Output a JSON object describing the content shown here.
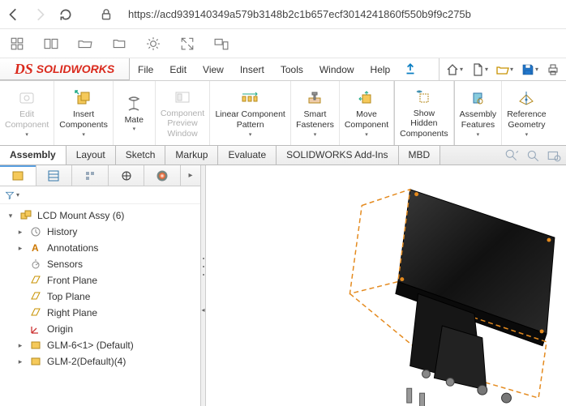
{
  "browser": {
    "url": "https://acd939140349a579b3148b2c1b657ecf3014241860f550b9f9c275b"
  },
  "app": {
    "logo": "SOLIDWORKS",
    "menus": [
      "File",
      "Edit",
      "View",
      "Insert",
      "Tools",
      "Window",
      "Help"
    ]
  },
  "ribbon": [
    {
      "id": "edit-component",
      "label": "Edit\nComponent",
      "disabled": true
    },
    {
      "id": "insert-components",
      "label": "Insert\nComponents"
    },
    {
      "id": "mate",
      "label": "Mate"
    },
    {
      "id": "component-preview",
      "label": "Component\nPreview\nWindow",
      "disabled": true
    },
    {
      "id": "linear-pattern",
      "label": "Linear Component\nPattern"
    },
    {
      "id": "smart-fasteners",
      "label": "Smart\nFasteners"
    },
    {
      "id": "move-component",
      "label": "Move\nComponent"
    },
    {
      "id": "show-hidden",
      "label": "Show\nHidden\nComponents"
    },
    {
      "id": "assembly-features",
      "label": "Assembly\nFeatures"
    },
    {
      "id": "reference-geometry",
      "label": "Reference\nGeometry"
    }
  ],
  "tabs": [
    "Assembly",
    "Layout",
    "Sketch",
    "Markup",
    "Evaluate",
    "SOLIDWORKS Add-Ins",
    "MBD"
  ],
  "active_tab": "Assembly",
  "tree": {
    "root": "LCD Mount Assy  (6)",
    "items": [
      {
        "label": "History",
        "icon": "history"
      },
      {
        "label": "Annotations",
        "icon": "annotations"
      },
      {
        "label": "Sensors",
        "icon": "sensors"
      },
      {
        "label": "Front Plane",
        "icon": "plane"
      },
      {
        "label": "Top Plane",
        "icon": "plane"
      },
      {
        "label": "Right Plane",
        "icon": "plane"
      },
      {
        "label": "Origin",
        "icon": "origin"
      },
      {
        "label": "GLM-6<1> (Default)",
        "icon": "part",
        "expandable": true
      },
      {
        "label": "GLM-2(Default)(4)",
        "icon": "part",
        "expandable": true
      }
    ]
  }
}
